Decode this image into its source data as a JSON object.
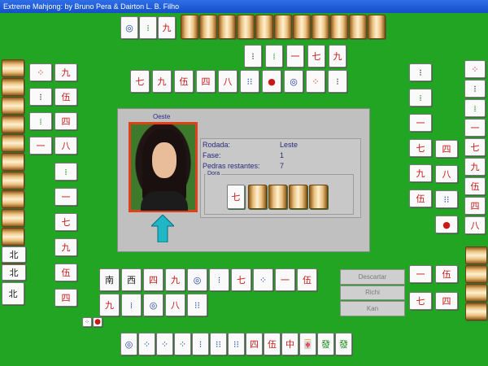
{
  "window": {
    "title": "Extreme Mahjong: by Bruno Pera & Dairton L. B. Filho"
  },
  "player": {
    "name": "Oeste"
  },
  "info": {
    "rodada_label": "Rodada:",
    "rodada_value": "Leste",
    "fase_label": "Fase:",
    "fase_value": "1",
    "pedras_label": "Pedras restantes:",
    "pedras_value": "7",
    "dora_label": "Dora"
  },
  "buttons": {
    "descartar": "Descartar",
    "richi": "Richi",
    "kan": "Kan"
  },
  "tiles": {
    "dora": "七",
    "player_hand": [
      "南",
      "西",
      "四",
      "九",
      "◎",
      "⁝",
      "七",
      "⁘",
      "一",
      "伍"
    ],
    "player_hand_row2": [
      "九",
      "⁞",
      "◎",
      "八",
      "⁝⁝"
    ],
    "bottom_discards": [
      "◎",
      "⁘",
      "⁘",
      "⁘",
      "⁝",
      "⁝⁝",
      "⁝⁝",
      "四",
      "伍",
      "中",
      "🀄",
      "發",
      "發"
    ],
    "east_hand_chars": [
      "北",
      "北",
      "北"
    ]
  }
}
